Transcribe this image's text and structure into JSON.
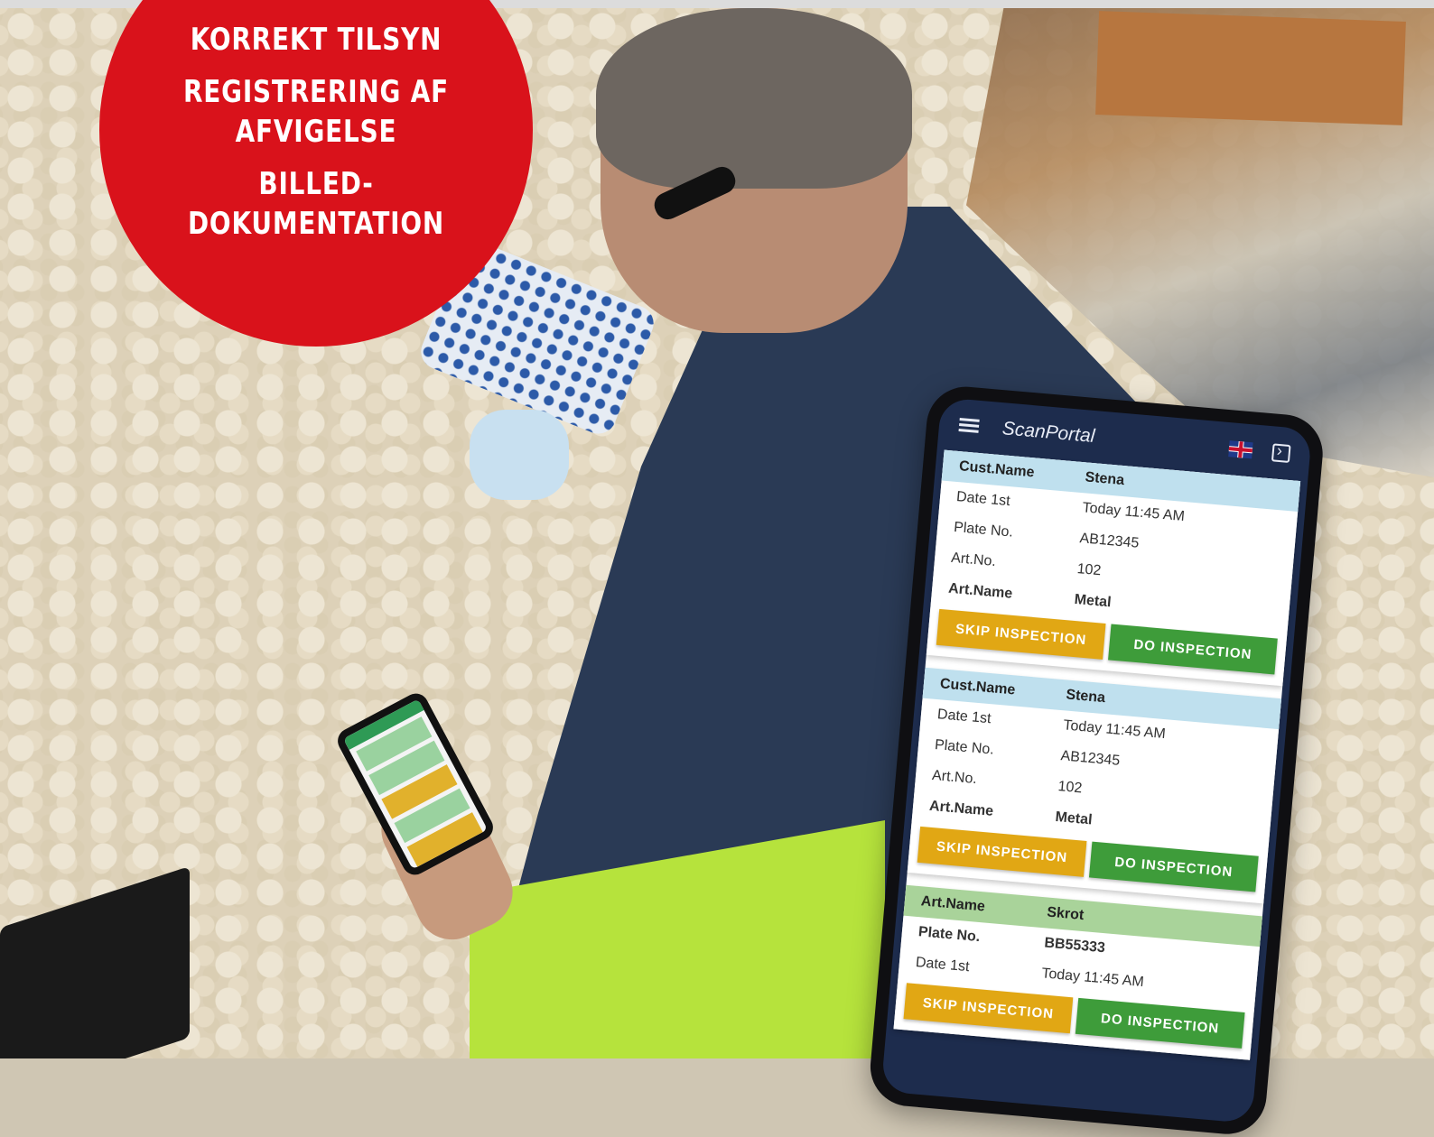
{
  "badge": {
    "line1": "KORREKT TILSYN",
    "line2": "REGISTRERING AF",
    "line3": "AFVIGELSE",
    "line4": "BILLED-",
    "line5": "DOKUMENTATION"
  },
  "app": {
    "title": "ScanPortal",
    "icons": [
      "menu-icon",
      "uk-flag-icon",
      "logout-icon"
    ]
  },
  "cards": [
    {
      "head": {
        "key": "Cust.Name",
        "value": "Stena"
      },
      "rows": [
        {
          "key": "Date 1st",
          "value": "Today 11:45 AM"
        },
        {
          "key": "Plate No.",
          "value": "AB12345"
        },
        {
          "key": "Art.No.",
          "value": "102"
        },
        {
          "key": "Art.Name",
          "value": "Metal"
        }
      ],
      "skip_label": "SKIP INSPECTION",
      "do_label": "DO INSPECTION"
    },
    {
      "head": {
        "key": "Cust.Name",
        "value": "Stena"
      },
      "rows": [
        {
          "key": "Date 1st",
          "value": "Today 11:45 AM"
        },
        {
          "key": "Plate No.",
          "value": "AB12345"
        },
        {
          "key": "Art.No.",
          "value": "102"
        },
        {
          "key": "Art.Name",
          "value": "Metal"
        }
      ],
      "skip_label": "SKIP INSPECTION",
      "do_label": "DO INSPECTION"
    },
    {
      "head": {
        "key": "Art.Name",
        "value": "Skrot"
      },
      "rows": [
        {
          "key": "Plate No.",
          "value": "BB55333"
        },
        {
          "key": "Date 1st",
          "value": "Today 11:45 AM"
        }
      ],
      "skip_label": "SKIP INSPECTION",
      "do_label": "DO INSPECTION"
    }
  ],
  "colors": {
    "badge": "#d9121b",
    "appbar": "#1d2c4d",
    "card_head_blue": "#bfe0ee",
    "card_head_green": "#a9d39a",
    "skip_button": "#e1a714",
    "do_button": "#3e9c3a"
  }
}
